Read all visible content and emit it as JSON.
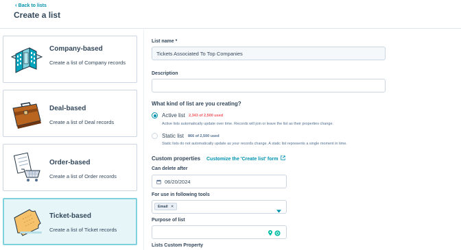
{
  "header": {
    "back_label": "Back to lists",
    "title": "Create a list"
  },
  "cards": [
    {
      "title": "Company-based",
      "desc": "Create a list of Company records",
      "icon": "building-icon"
    },
    {
      "title": "Deal-based",
      "desc": "Create a list of Deal records",
      "icon": "briefcase-icon"
    },
    {
      "title": "Order-based",
      "desc": "Create a list of Order records",
      "icon": "cart-icon"
    },
    {
      "title": "Ticket-based",
      "desc": "Create a list of Ticket records",
      "icon": "ticket-icon",
      "selected": true
    }
  ],
  "form": {
    "list_name_label": "List name *",
    "list_name_value": "Tickets Associated To Top Companies",
    "description_label": "Description",
    "description_value": "",
    "question": "What kind of list are you creating?",
    "active": {
      "label": "Active list",
      "usage": "2,343 of 2,500 used",
      "desc": "Active lists automatically update over time. Records will join or leave the list as their properties change.",
      "checked": true
    },
    "static": {
      "label": "Static list",
      "usage": "866 of 2,500 used",
      "desc": "Static lists do not automatically update as your records change. A static list represents a single moment in time.",
      "checked": false
    },
    "custom_props_title": "Custom properties",
    "custom_props_link": "Customize the 'Create list' form",
    "can_delete_label": "Can delete after",
    "can_delete_value": "06/20/2024",
    "tools_label": "For use in following tools",
    "tools_chip": "Email",
    "purpose_label": "Purpose of list",
    "purpose_value": "",
    "lists_custom_label": "Lists Custom Property"
  },
  "colors": {
    "accent": "#0091ae",
    "selected_bg": "#e5f5f8",
    "warning": "#f2545b"
  }
}
